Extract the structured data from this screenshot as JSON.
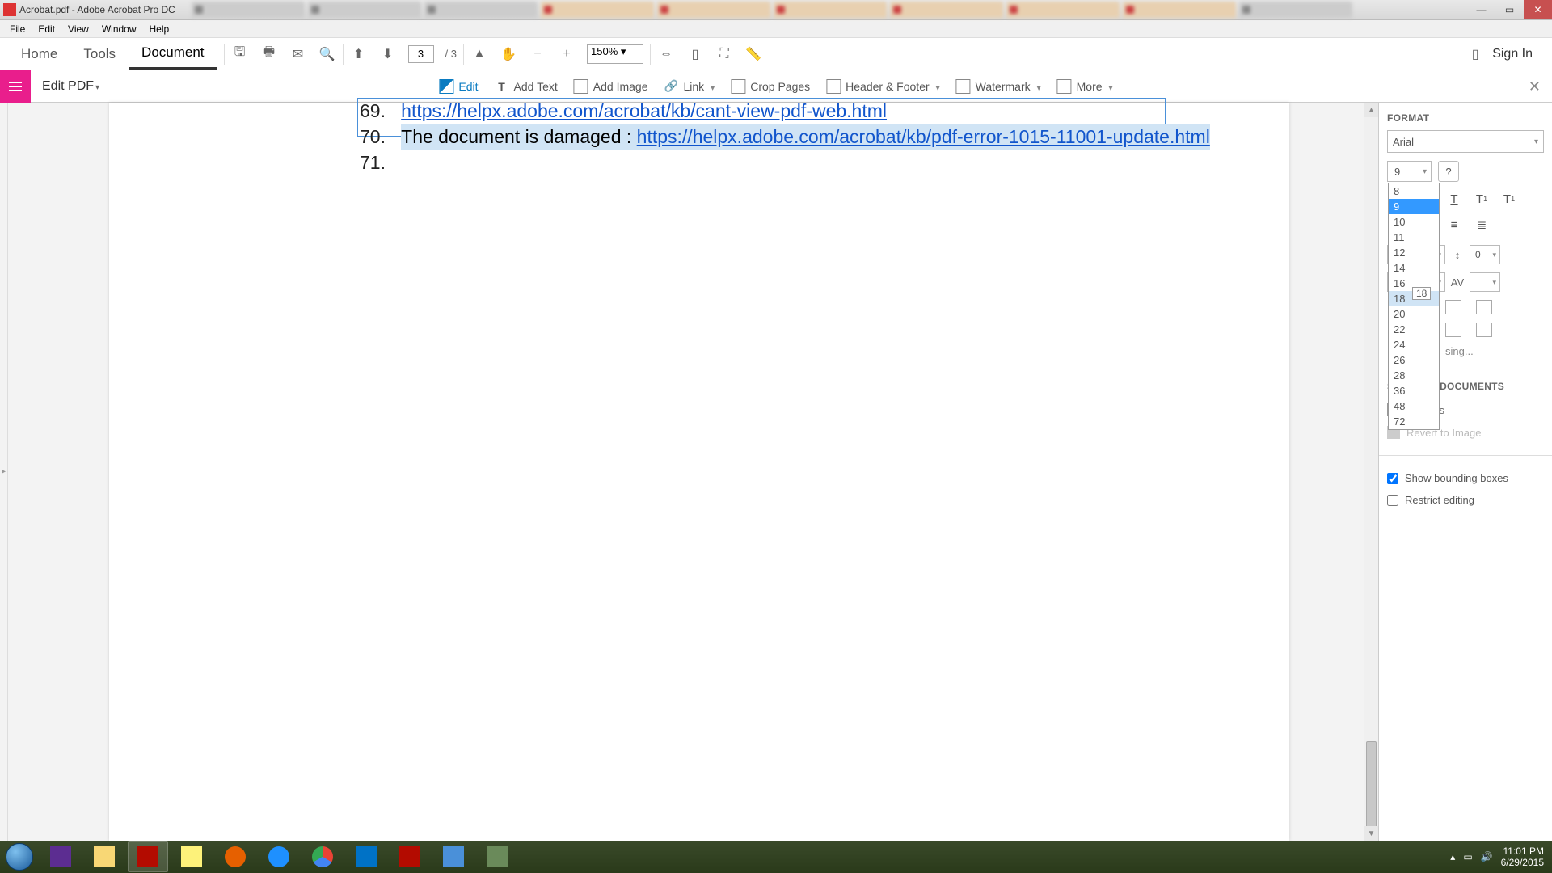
{
  "titlebar": {
    "filename": "Acrobat.pdf",
    "appname": "Adobe Acrobat Pro DC"
  },
  "menubar": [
    "File",
    "Edit",
    "View",
    "Window",
    "Help"
  ],
  "doctabs": {
    "home": "Home",
    "tools": "Tools",
    "document": "Document"
  },
  "toolbar": {
    "page_current": "3",
    "page_total": "/ 3",
    "zoom": "150%",
    "signin": "Sign In"
  },
  "edittb": {
    "title": "Edit PDF",
    "edit": "Edit",
    "addtext": "Add Text",
    "addimage": "Add Image",
    "link": "Link",
    "crop": "Crop Pages",
    "headerfooter": "Header & Footer",
    "watermark": "Watermark",
    "more": "More"
  },
  "content": {
    "line69_num": "69.",
    "line69_link": "https://helpx.adobe.com/acrobat/kb/cant-view-pdf-web.html",
    "line70_num": "70.",
    "line70_text": "The document is damaged : ",
    "line70_link": "https://helpx.adobe.com/acrobat/kb/pdf-error-1015-11001-update.html",
    "line71_num": "71."
  },
  "format": {
    "title": "FORMAT",
    "font": "Arial",
    "size": "9",
    "sizes": [
      "8",
      "9",
      "10",
      "11",
      "12",
      "14",
      "16",
      "18",
      "20",
      "22",
      "24",
      "26",
      "28",
      "36",
      "48",
      "72"
    ],
    "sizes_selected": "9",
    "sizes_hover": "18",
    "tooltip": "18",
    "linespacing": "0",
    "sing_text": "sing...",
    "scanned_title": "SCANNED DOCUMENTS",
    "settings": "Settings",
    "revert": "Revert to Image",
    "show_bb": "Show bounding boxes",
    "restrict": "Restrict editing",
    "show_bb_checked": true,
    "restrict_checked": false
  },
  "tray": {
    "time": "11:01 PM",
    "date": "6/29/2015"
  }
}
